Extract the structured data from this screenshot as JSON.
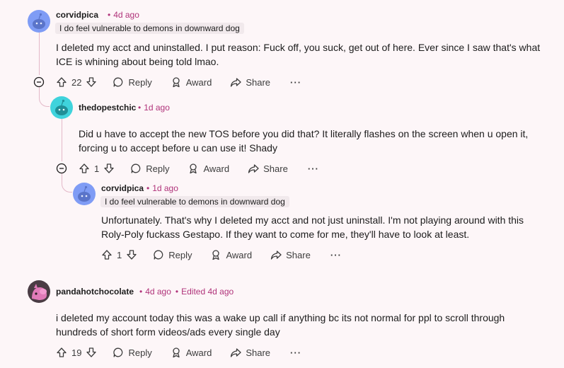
{
  "comments": [
    {
      "username": "corvidpica",
      "time": "4d ago",
      "flair": "I do feel vulnerable to demons in downward dog",
      "body_lines": [
        "I deleted my acct and uninstalled. I put reason: Fuck off, you suck, get out of here. Ever since I saw that's what",
        "ICE is whining about being told lmao."
      ],
      "votes": "22",
      "reply_label": "Reply",
      "award_label": "Award",
      "share_label": "Share",
      "more_label": "···"
    },
    {
      "username": "thedopestchic",
      "time": "1d ago",
      "body_lines": [
        "Did u have to accept the new TOS before you did that? It literally flashes on the screen when u open it,",
        "forcing u to accept before u can use it! Shady"
      ],
      "votes": "1",
      "reply_label": "Reply",
      "award_label": "Award",
      "share_label": "Share",
      "more_label": "···"
    },
    {
      "username": "corvidpica",
      "time": "1d ago",
      "flair": "I do feel vulnerable to demons in downward dog",
      "body_lines": [
        "Unfortunately. That's why I deleted my acct and not just uninstall. I'm not playing around with this",
        "Roly-Poly fuckass Gestapo. If they want to come for me, they'll have to look at least."
      ],
      "votes": "1",
      "reply_label": "Reply",
      "award_label": "Award",
      "share_label": "Share",
      "more_label": "···"
    },
    {
      "username": "pandahotchocolate",
      "time": "4d ago",
      "edited": "Edited 4d ago",
      "body_lines": [
        "i deleted my account today this was a wake up call if anything bc its not normal for ppl to scroll through",
        "hundreds of short form videos/ads every single day"
      ],
      "votes": "19",
      "reply_label": "Reply",
      "award_label": "Award",
      "share_label": "Share",
      "more_label": "···"
    }
  ],
  "colors": {
    "background": "#fdf6f8",
    "meta_pink": "#b0337a",
    "thread_line": "#e3b8c8",
    "avatar_blue": "#7f9cf5",
    "avatar_teal": "#3fd3dc",
    "avatar_pink": "#e07ab8"
  }
}
